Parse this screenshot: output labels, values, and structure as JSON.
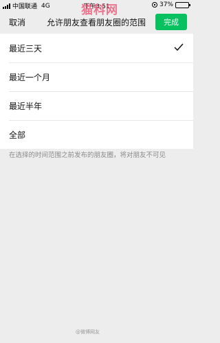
{
  "status_bar": {
    "carrier": "中国联通",
    "network": "4G",
    "time": "下午3:51",
    "battery": "37%",
    "battery_level": 0.37
  },
  "nav": {
    "cancel_label": "取消",
    "title": "允许朋友查看朋友圈的范围",
    "done_label": "完成"
  },
  "options": [
    {
      "label": "最近三天",
      "selected": true
    },
    {
      "label": "最近一个月",
      "selected": false
    },
    {
      "label": "最近半年",
      "selected": false
    },
    {
      "label": "全部",
      "selected": false
    }
  ],
  "note": "在选择的时间范围之前发布的朋友圈，将对朋友不可见",
  "watermark": "猫科网",
  "weibo_mark": "@微博网友",
  "colors": {
    "accent": "#07c160",
    "background": "#ededed",
    "watermark": "#e94b6e"
  }
}
